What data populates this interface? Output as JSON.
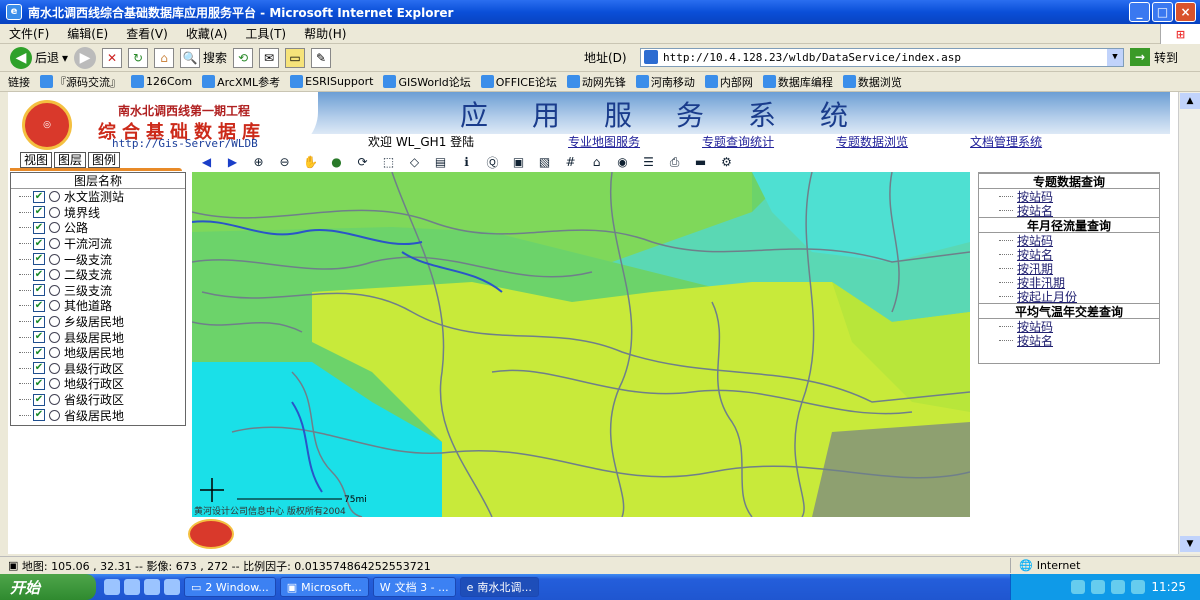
{
  "window": {
    "title": "南水北调西线综合基础数据库应用服务平台 - Microsoft Internet Explorer",
    "controls": [
      "_",
      "□",
      "×"
    ]
  },
  "menu": [
    "文件(F)",
    "编辑(E)",
    "查看(V)",
    "收藏(A)",
    "工具(T)",
    "帮助(H)"
  ],
  "toolbar": {
    "back": "后退",
    "search": "搜索"
  },
  "address": {
    "label": "地址(D)",
    "url": "http://10.4.128.23/wldb/DataService/index.asp",
    "go": "转到"
  },
  "links": {
    "label": "链接",
    "items": [
      "『源码交流』",
      "126Com",
      "ArcXML参考",
      "ESRISupport",
      "GISWorld论坛",
      "OFFICE论坛",
      "动网先锋",
      "河南移动",
      "内部网",
      "数据库编程",
      "数据浏览"
    ]
  },
  "header": {
    "project": "南水北调西线第一期工程",
    "db_name": "综合基础数据库",
    "server": "http://Gis-Server/WLDB",
    "title": "应用服务系统",
    "welcome": "欢迎 WL_GH1 登陆",
    "nav": [
      "专业地图服务",
      "专题查询统计",
      "专题数据浏览",
      "文档管理系统"
    ]
  },
  "tabs": [
    "视图",
    "图层",
    "图例"
  ],
  "layers": {
    "header": "图层名称",
    "items": [
      "水文监测站",
      "境界线",
      "公路",
      "干流河流",
      "一级支流",
      "二级支流",
      "三级支流",
      "其他道路",
      "乡级居民地",
      "县级居民地",
      "地级居民地",
      "县级行政区",
      "地级行政区",
      "省级行政区",
      "省级居民地"
    ]
  },
  "map": {
    "scale_label": "75mi",
    "copyright": "黄河设计公司信息中心 版权所有2004"
  },
  "queries": [
    {
      "title": "专题数据查询",
      "items": [
        "按站码",
        "按站名"
      ]
    },
    {
      "title": "年月径流量查询",
      "items": [
        "按站码",
        "按站名",
        "按汛期",
        "按非汛期",
        "按起止月份"
      ]
    },
    {
      "title": "平均气温年交差查询",
      "items": [
        "按站码",
        "按站名"
      ]
    }
  ],
  "status": {
    "text": "地图: 105.06 , 32.31 -- 影像: 673 , 272 -- 比例因子: 0.013574864252553721",
    "zone": "Internet"
  },
  "taskbar": {
    "start": "开始",
    "tasks": [
      "2 Window...",
      "Microsoft...",
      "文档 3 - ...",
      "南水北调..."
    ],
    "time": "11:25"
  }
}
